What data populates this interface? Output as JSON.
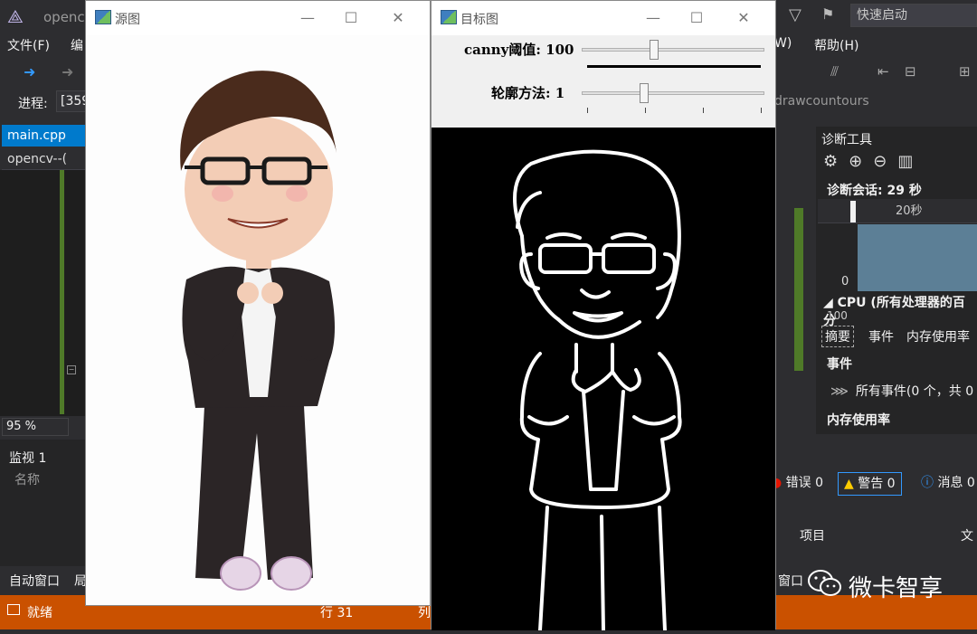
{
  "vs": {
    "title": "opencv",
    "menu": [
      "文件(F)",
      "编"
    ],
    "menu_right_w": "W)",
    "menu_help": "帮助(H)",
    "quick_launch": "快速启动",
    "process_label": "进程:",
    "process_value": "[359",
    "tab_main": "main.cpp",
    "tab_sub": "opencv--(",
    "zoom": "95 %",
    "watch_title": "监视 1",
    "watch_col_name": "名称",
    "bottom_tab_auto": "自动窗口",
    "bottom_tab_local": "局",
    "bottom_tab_right": "窗口",
    "status_ready": "就绪",
    "status_line": "行 31",
    "status_col": "列",
    "draw_tab": "drawcountours",
    "diag": {
      "title": "诊断工具",
      "session": "诊断会话: 29 秒",
      "time_label": "20秒",
      "zero": "0",
      "cpu": "CPU (所有处理器的百分",
      "cpu_value": "100",
      "tab_summary": "摘要",
      "tab_events": "事件",
      "tab_mem": "内存使用率",
      "events_header": "事件",
      "events_row": "所有事件(0 个，共 0",
      "mem_header": "内存使用率"
    },
    "errors": {
      "errors": "错误 0",
      "warnings": "警告 0",
      "messages": "消息 0"
    },
    "proj_col": "项目",
    "file_col": "文",
    "watermark": "微卡智享"
  },
  "src_window": {
    "title": "源图"
  },
  "dst_window": {
    "title": "目标图",
    "canny_label": "canny阈值: 100",
    "canny_value": 100,
    "canny_max": 255,
    "contour_label": "轮廓方法: 1",
    "contour_value": 1,
    "contour_max": 3
  },
  "colors": {
    "vs_bg": "#2d2d30",
    "status_orange": "#ca5100",
    "accent_blue": "#007acc",
    "suit": "#2b2526",
    "skin": "#f3cdb6",
    "hair": "#4a2b1c"
  }
}
